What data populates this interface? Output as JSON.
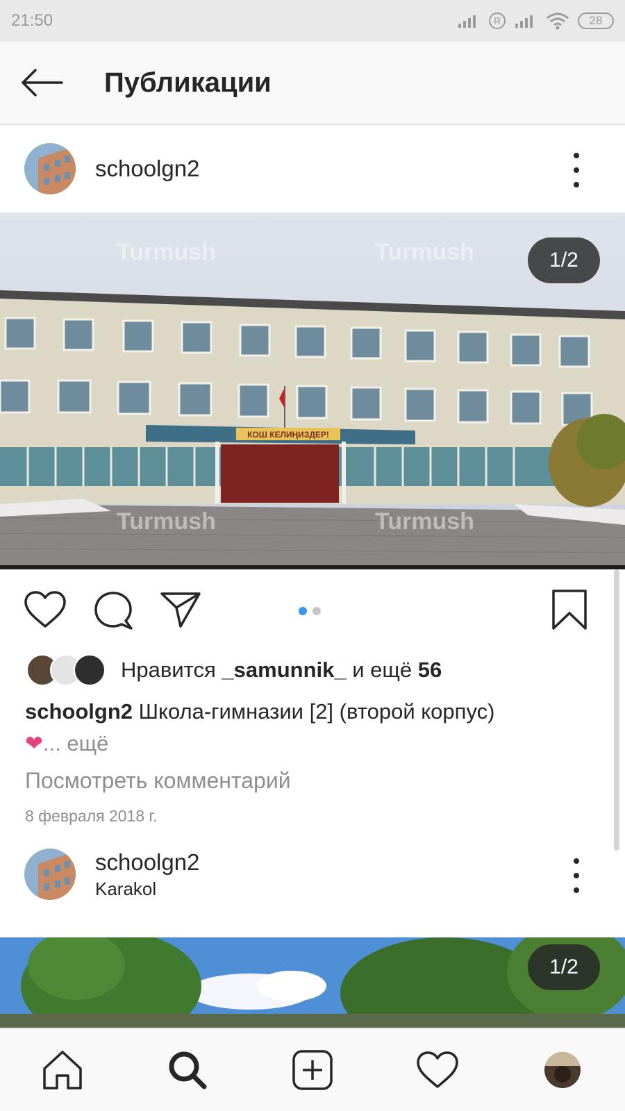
{
  "status_bar": {
    "time": "21:50",
    "battery": "28",
    "sim_label": "R"
  },
  "header": {
    "title": "Публикации",
    "back_icon": "arrow-left-icon"
  },
  "posts": [
    {
      "username": "schoolgn2",
      "location": "",
      "page_indicator": "1/2",
      "likes": {
        "prefix": "Нравится",
        "user": "_samunnik_",
        "middle": "и ещё",
        "count": "56"
      },
      "caption": {
        "user": "schoolgn2",
        "text": "Школа-гимназии [2] (второй корпус)",
        "emoji": "❤",
        "more": "... ещё"
      },
      "view_comments": "Посмотреть комментарий",
      "date": "8 февраля 2018 г.",
      "carousel": {
        "total": 2,
        "active": 0
      },
      "image_text": {
        "banner": "КОШ КЕЛИҢИЗДЕР!",
        "watermark": "Turmush"
      }
    },
    {
      "username": "schoolgn2",
      "location": "Karakol",
      "page_indicator": "1/2"
    }
  ],
  "bottom_nav": [
    "home-icon",
    "search-icon",
    "add-post-icon",
    "activity-heart-icon",
    "profile-avatar"
  ],
  "colors": {
    "accent": "#3897f0",
    "text": "#262626",
    "muted": "#8e8e8e",
    "heart": "#e0457b"
  }
}
